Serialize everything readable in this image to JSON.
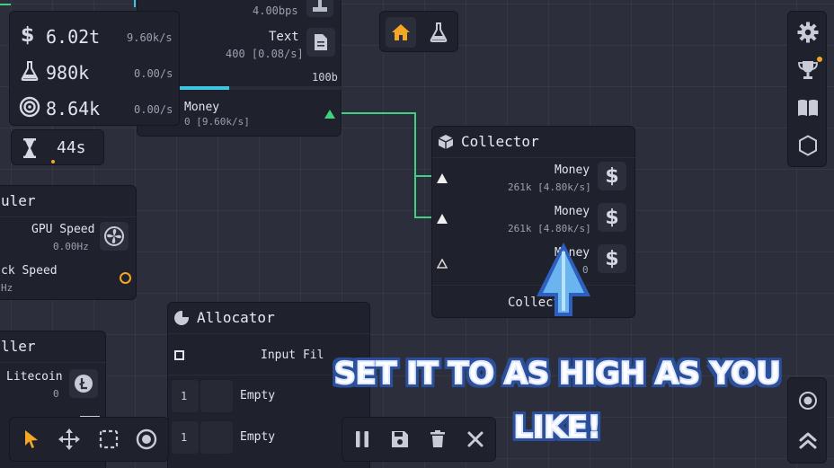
{
  "colors": {
    "accent_orange": "#f5a623",
    "link_green": "#3fd17f",
    "progress_cyan": "#3ec7e0",
    "banner_outline": "#2c4f9a"
  },
  "resources": [
    {
      "icon": "dollar-icon",
      "value": "6.02t",
      "rate": "9.60k/s"
    },
    {
      "icon": "flask-icon",
      "value": "980k",
      "rate": "0.00/s"
    },
    {
      "icon": "target-icon",
      "value": "8.64k",
      "rate": "0.00/s"
    }
  ],
  "timer": {
    "value": "44s"
  },
  "top_node": {
    "bps": "4.00bps",
    "text_label": "Text",
    "text_sub": "400 [0.08/s]",
    "size": "100b",
    "progress": 0.45,
    "money_label": "Money",
    "money_sub": "0 [9.60k/s]"
  },
  "collector": {
    "title": "Collector",
    "rows": [
      {
        "label": "Money",
        "sub": "261k [4.80k/s]"
      },
      {
        "label": "Money",
        "sub": "261k [4.80k/s]"
      },
      {
        "label": "Money",
        "sub": "0"
      }
    ],
    "button": "Collect"
  },
  "scheduler": {
    "title": "uler",
    "gpu_label": "GPU Speed",
    "gpu_value": "0.00Hz",
    "clock_label": "ck Speed",
    "clock_value": "Hz"
  },
  "controller": {
    "title": "ller",
    "coin_label": "Litecoin",
    "coin_value": "0"
  },
  "allocator": {
    "title": "Allocator",
    "filter_label": "Input Fil",
    "slots": [
      {
        "num": "1",
        "label": "Empty"
      },
      {
        "num": "1",
        "label": "Empty"
      }
    ]
  },
  "banner": {
    "text": "SET IT TO AS HIGH AS YOU LIKE!"
  },
  "top_tabs": [
    {
      "icon": "home-icon"
    },
    {
      "icon": "flask-icon"
    }
  ],
  "right_menu": [
    {
      "icon": "gear-icon"
    },
    {
      "icon": "trophy-icon"
    },
    {
      "icon": "book-icon"
    },
    {
      "icon": "hexagon-icon"
    }
  ],
  "tools": [
    {
      "icon": "cursor-icon"
    },
    {
      "icon": "move-icon"
    },
    {
      "icon": "select-icon"
    },
    {
      "icon": "circle-icon"
    }
  ],
  "actions": [
    {
      "icon": "pause-icon"
    },
    {
      "icon": "save-icon"
    },
    {
      "icon": "trash-icon"
    },
    {
      "icon": "close-icon"
    }
  ]
}
